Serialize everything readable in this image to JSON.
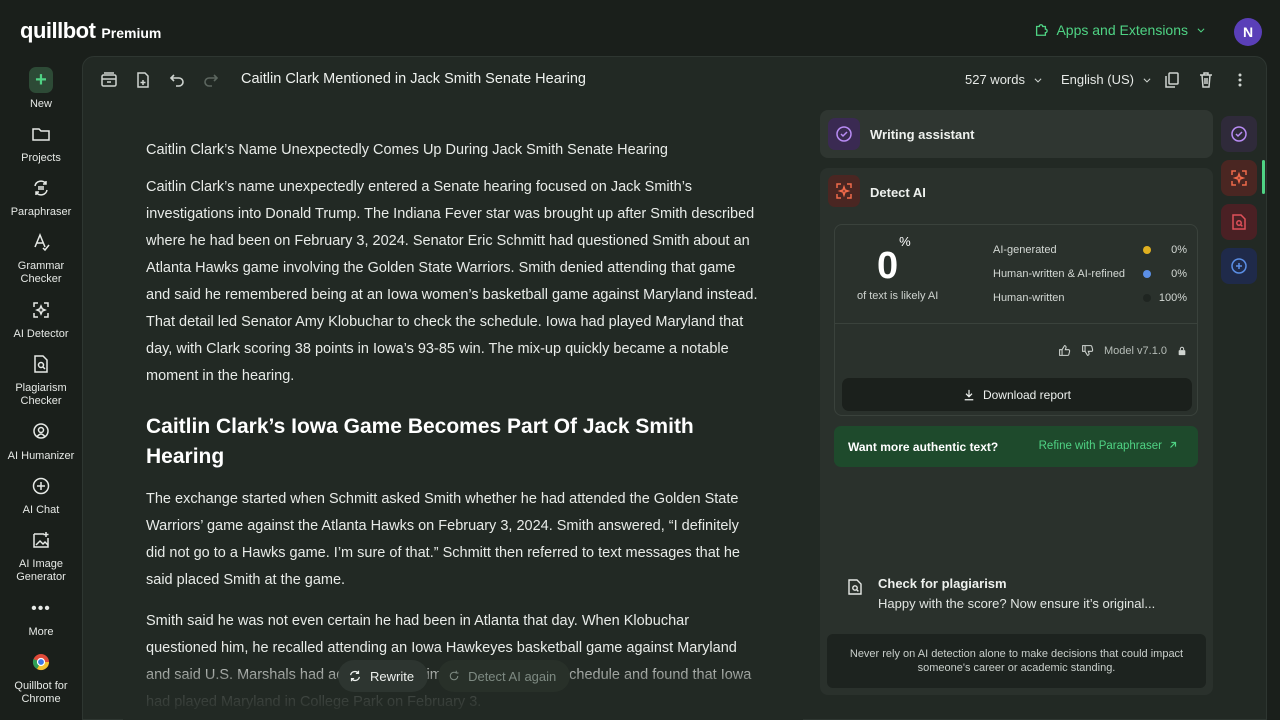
{
  "brand": {
    "logo_text": "quillbot",
    "tier": "Premium"
  },
  "header": {
    "apps_label": "Apps and Extensions",
    "avatar_initial": "N"
  },
  "sidebar": {
    "items": [
      {
        "label": "New",
        "icon": "plus-icon"
      },
      {
        "label": "Projects",
        "icon": "folder-icon"
      },
      {
        "label": "Paraphraser",
        "icon": "paraphrase-icon"
      },
      {
        "label": "Grammar Checker",
        "icon": "grammar-icon"
      },
      {
        "label": "AI Detector",
        "icon": "ai-detector-icon"
      },
      {
        "label": "Plagiarism Checker",
        "icon": "plagiarism-icon"
      },
      {
        "label": "AI Humanizer",
        "icon": "humanizer-icon"
      },
      {
        "label": "AI Chat",
        "icon": "chat-icon"
      },
      {
        "label": "AI Image Generator",
        "icon": "image-generator-icon"
      },
      {
        "label": "More",
        "icon": "more-icon"
      },
      {
        "label": "Quillbot for Chrome",
        "icon": "chrome-icon"
      }
    ]
  },
  "toolbar": {
    "doc_title": "Caitlin Clark Mentioned in Jack Smith Senate Hearing",
    "word_count": "527 words",
    "language": "English (US)"
  },
  "editor": {
    "p1": "Caitlin Clark’s Name Unexpectedly Comes Up During Jack Smith Senate Hearing",
    "p2": "Caitlin Clark’s name unexpectedly entered a Senate hearing focused on Jack Smith’s investigations into Donald Trump. The Indiana Fever star was brought up after Smith described where he had been on February 3, 2024. Senator Eric Schmitt had questioned Smith about an Atlanta Hawks game involving the Golden State Warriors. Smith denied attending that game and said he remembered being at an Iowa women’s basketball game against Maryland instead. That detail led Senator Amy Klobuchar to check the schedule. Iowa had played Maryland that day, with Clark scoring 38 points in Iowa’s 93-85 win. The mix-up quickly became a notable moment in the hearing.",
    "h2": "Caitlin Clark’s Iowa Game Becomes Part Of Jack Smith Hearing",
    "p3": "The exchange started when Schmitt asked Smith whether he had attended the Golden State Warriors’ game against the Atlanta Hawks on February 3, 2024. Smith answered, “I definitely did not go to a Hawks game. I’m sure of that.” Schmitt then referred to text messages that he said placed Smith at the game.",
    "p4": "Smith said he was not even certain he had been in Atlanta that day. When Klobuchar questioned him, he recalled attending an Iowa Hawkeyes basketball game against Maryland and said U.S. Marshals had accompanied him. She checked the schedule and found that Iowa had played Maryland in College Park on February 3."
  },
  "floating": {
    "rewrite": "Rewrite",
    "detect_again": "Detect AI again"
  },
  "panel": {
    "writing_assistant": "Writing assistant",
    "detect_ai": "Detect AI",
    "score_value": "0",
    "score_unit": "%",
    "score_caption": "of text is likely AI",
    "legend": [
      {
        "label": "AI-generated",
        "pct": "0%",
        "color": "#e0b020"
      },
      {
        "label": "Human-written & AI-refined",
        "pct": "0%",
        "color": "#5b8fe6"
      },
      {
        "label": "Human-written",
        "pct": "100%",
        "color": "#2a312c"
      }
    ],
    "model": "Model v7.1.0",
    "download": "Download report",
    "authentic_q": "Want more authentic text?",
    "refine": "Refine with Paraphraser",
    "plag_title": "Check for plagiarism",
    "plag_sub": "Happy with the score? Now ensure it’s original...",
    "notice": "Never rely on AI detection alone to make decisions that could impact someone's career or academic standing."
  },
  "colors": {
    "accent": "#4fd384",
    "background": "#1a1f1b",
    "editor_bg": "#222924"
  }
}
